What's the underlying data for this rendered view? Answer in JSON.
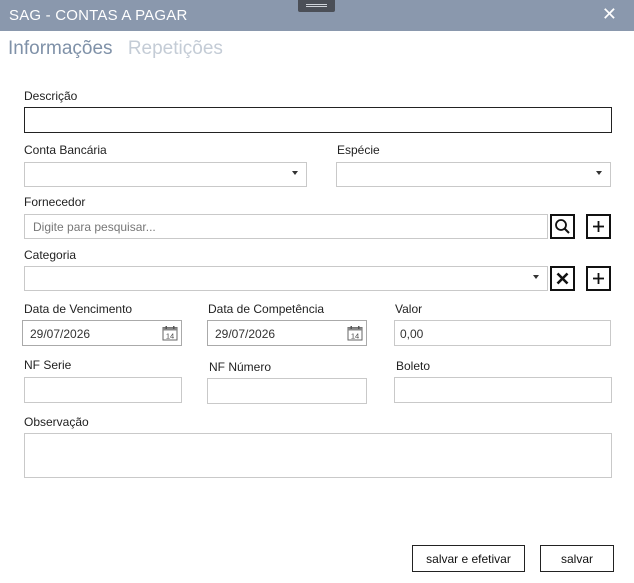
{
  "window": {
    "title": "SAG - CONTAS A PAGAR",
    "close_glyph": "✕"
  },
  "tabs": [
    {
      "label": "Informações"
    },
    {
      "label": "Repetições"
    }
  ],
  "form": {
    "descricao": {
      "label": "Descrição",
      "value": ""
    },
    "conta_bancaria": {
      "label": "Conta Bancária",
      "value": ""
    },
    "especie": {
      "label": "Espécie",
      "value": ""
    },
    "fornecedor": {
      "label": "Fornecedor",
      "placeholder": "Digite para pesquisar..."
    },
    "categoria": {
      "label": "Categoria",
      "value": ""
    },
    "data_vencimento": {
      "label": "Data de Vencimento",
      "value": "29/07/2026"
    },
    "data_competencia": {
      "label": "Data de Competência",
      "value": "29/07/2026"
    },
    "valor": {
      "label": "Valor",
      "value": "0,00"
    },
    "nf_serie": {
      "label": "NF Serie",
      "value": ""
    },
    "nf_numero": {
      "label": "NF Número",
      "value": ""
    },
    "boleto": {
      "label": "Boleto",
      "value": ""
    },
    "observacao": {
      "label": "Observação",
      "value": ""
    },
    "calendar_day": "14"
  },
  "buttons": {
    "salvar_efetivar": "salvar e efetivar",
    "salvar": "salvar"
  },
  "colors": {
    "titlebar": "#8a98ad",
    "tab_active": "#7f91a8",
    "tab_inactive": "#c4ccd6"
  },
  "icons": [
    "close-icon",
    "window-grip-icon",
    "dropdown-arrow-icon",
    "search-icon",
    "add-icon",
    "clear-icon",
    "calendar-icon"
  ]
}
